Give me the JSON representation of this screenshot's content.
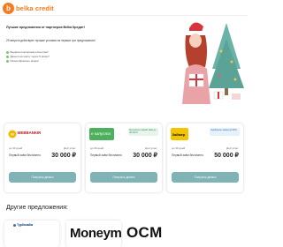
{
  "header": {
    "logo_mark": "b",
    "logo_text": "belka credit"
  },
  "hero": {
    "title": "Лучшие предложения от партнеров Belka Кредит!",
    "subtitle": "29 августа действуют лучшие условия на первые три предложения!",
    "benefits": [
      "Выдача повторным клиентам!",
      "Деньги на карту через 5 минут!",
      "Разнообразные акции!"
    ]
  },
  "cards": [
    {
      "logo": "WEBBANKIR",
      "badge": "",
      "term_label": "до 30 дней",
      "loan_label": "Первый заём бесплатно",
      "avail_label": "Доступно:",
      "amount": "30 000 ₽",
      "button": "Получить деньги",
      "logo_color": "#f2b705"
    },
    {
      "logo": "е капуста",
      "badge": "Бесплатно первый заём до 30 000 ₽",
      "term_label": "до 30 дней",
      "loan_label": "Первый заём бесплатно",
      "avail_label": "Доступно:",
      "amount": "30 000 ₽",
      "button": "Получить деньги",
      "logo_color": "#4db05c"
    },
    {
      "logo": "Займер",
      "badge": "Одобрение заявок до 96%",
      "term_label": "до 30 дней",
      "loan_label": "Первый заём бесплатно",
      "avail_label": "Доступно:",
      "amount": "50 000 ₽",
      "button": "Получить деньги",
      "logo_color": "#f5c400"
    }
  ],
  "other": {
    "title": "Другие предложения:",
    "items": [
      {
        "name": "Турбозайм"
      },
      {
        "name": "Moneyman"
      },
      {
        "name": "OCM"
      }
    ]
  },
  "colors": {
    "brand": "#f47b20",
    "button": "#7fb3b6",
    "tree": "#4fa59a"
  }
}
